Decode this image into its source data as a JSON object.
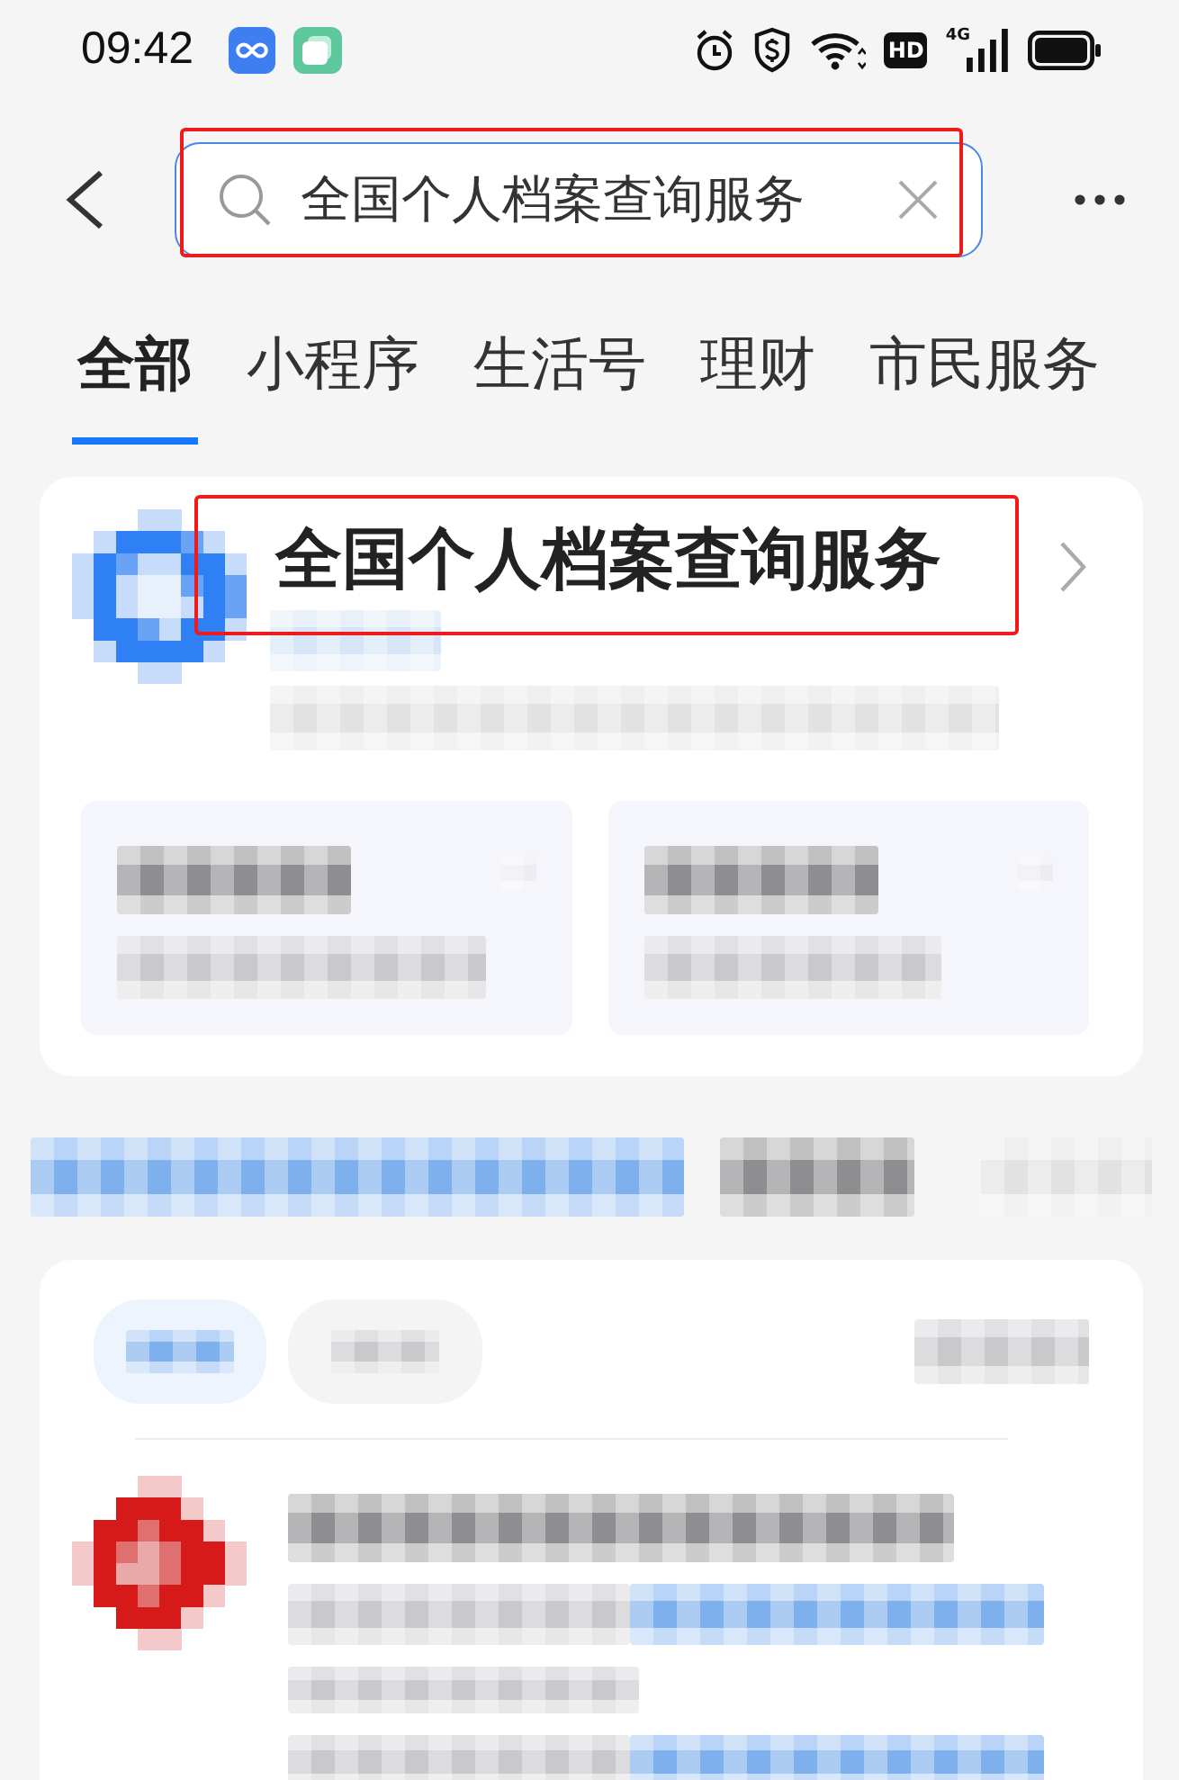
{
  "status_bar": {
    "time": "09:42",
    "hd_badge": "HD",
    "network_type": "4G"
  },
  "search": {
    "value": "全国个人档案查询服务",
    "highlighted": true
  },
  "tabs": [
    {
      "label": "全部",
      "selected": true
    },
    {
      "label": "小程序",
      "selected": false
    },
    {
      "label": "生活号",
      "selected": false
    },
    {
      "label": "理财",
      "selected": false
    },
    {
      "label": "市民服务",
      "selected": false
    }
  ],
  "result_card": {
    "title": "全国个人档案查询服务",
    "highlighted": true
  }
}
